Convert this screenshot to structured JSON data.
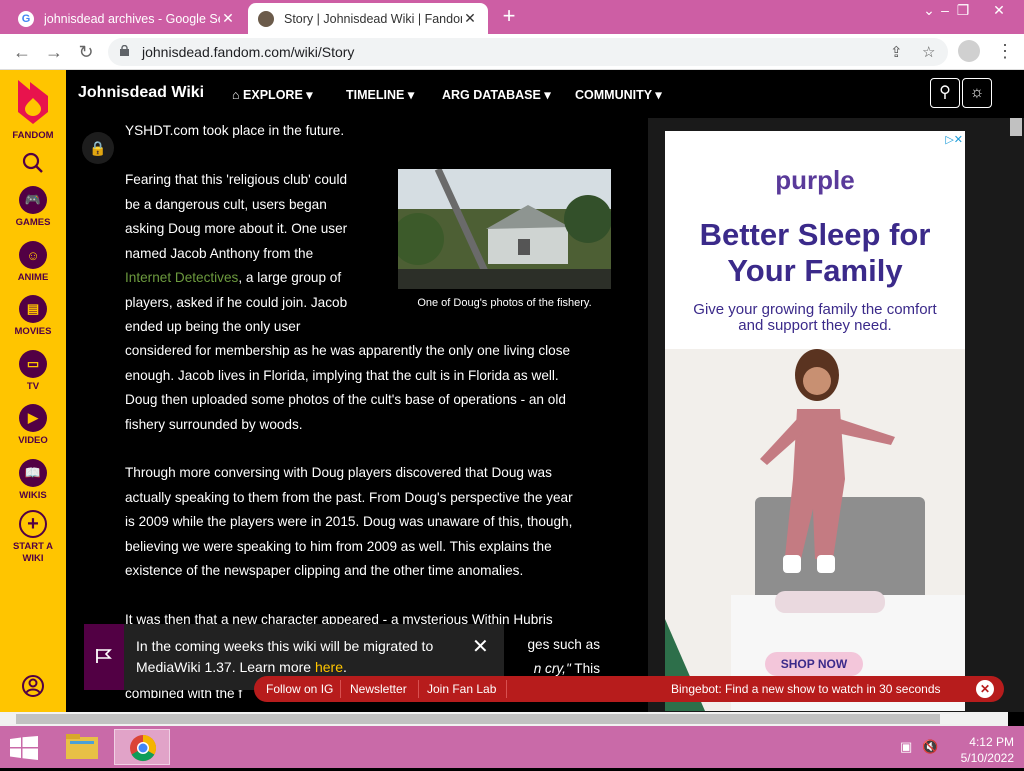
{
  "browser": {
    "tabs": [
      {
        "title": "johnisdead archives - Google Se",
        "favicon": "google-icon"
      },
      {
        "title": "Story | Johnisdead Wiki | Fandom",
        "favicon": "fandom-wiki-icon"
      }
    ],
    "url": "johnisdead.fandom.com/wiki/Story"
  },
  "rail": {
    "items": [
      {
        "label": "FANDOM",
        "icon": "fandom-logo-icon"
      },
      {
        "label": "",
        "icon": "search-icon"
      },
      {
        "label": "GAMES",
        "icon": "games-icon"
      },
      {
        "label": "ANIME",
        "icon": "anime-icon"
      },
      {
        "label": "MOVIES",
        "icon": "movies-icon"
      },
      {
        "label": "TV",
        "icon": "tv-icon"
      },
      {
        "label": "VIDEO",
        "icon": "video-icon"
      },
      {
        "label": "WIKIS",
        "icon": "wikis-icon"
      },
      {
        "label": "START A WIKI",
        "icon": "plus-icon"
      }
    ]
  },
  "header": {
    "wiki_name": "Johnisdead Wiki",
    "nav": [
      "EXPLORE",
      "TIMELINE",
      "ARG DATABASE",
      "COMMUNITY"
    ]
  },
  "content": {
    "p0": "YSHDT.com took place in the future.",
    "p1_lines": [
      "Fearing that this 'religious club' could",
      "be a dangerous cult, users began",
      "asking Doug more about it. One user",
      "named Jacob Anthony from the"
    ],
    "p1_link": "Internet Detectives",
    "p1_after_link": ", a large group of",
    "p1_lines2": [
      "players, asked if he could join. Jacob",
      "ended up being the only user",
      "considered for membership as he was apparently the only one living close",
      "enough. Jacob lives in Florida, implying that the cult is in Florida as well.",
      "Doug then uploaded some photos of the cult's base of operations - an old",
      "fishery surrounded by woods."
    ],
    "p2_lines": [
      "Through more conversing with Doug players discovered that Doug was",
      "actually speaking to them from the past. From Doug's perspective the year",
      "is 2009 while the players were in 2015. Doug was unaware of this, though,",
      "believing we were speaking to him from 2009 as well. This explains the",
      "existence of the newspaper clipping and the other time anomalies."
    ],
    "p3_line1": "It was then that a new character appeared - a mysterious Within Hubris",
    "p3_frag1": "ges such as",
    "p3_frag2": "n cry,\"",
    "p3_frag2b": " This",
    "p3_line4": "combined with the f",
    "figure_caption": "One of Doug's photos of the fishery."
  },
  "ad": {
    "brand": "purple",
    "headline": "Better Sleep for Your Family",
    "sub": "Give your growing family the comfort and support they need.",
    "cta": "SHOP NOW"
  },
  "notice": {
    "text_before": "In the coming weeks this wiki will be migrated to MediaWiki 1.37. Learn more ",
    "link": "here",
    "text_after": "."
  },
  "bottombar": {
    "links": [
      "Follow on IG",
      "Newsletter",
      "Join Fan Lab"
    ],
    "promo": "Bingebot: Find a new show to watch in 30 seconds"
  },
  "taskbar": {
    "time": "4:12 PM",
    "date": "5/10/2022"
  }
}
